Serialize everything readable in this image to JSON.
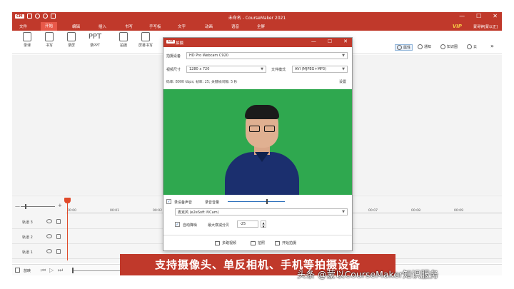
{
  "window": {
    "logo": "CM",
    "title": "未命名 - CourseMaker 2021",
    "min": "—",
    "max": "☐",
    "close": "✕"
  },
  "menu": {
    "items": [
      "文件",
      "开始",
      "编辑",
      "插入",
      "书写",
      "手写板",
      "文字",
      "动画",
      "语音",
      "全屏"
    ],
    "vip": "VIP",
    "user": "蒙哥钟[蒙以正]"
  },
  "ribbon": {
    "tools": [
      "录课",
      "书写",
      "录屏",
      "录PPT",
      "拍摄",
      "屏幕书写"
    ],
    "ppt_glyph": "PPT",
    "right_tools": [
      "属性",
      "通知",
      "知识圈",
      "云"
    ],
    "more": "»"
  },
  "timeline": {
    "ticks": [
      "00:00",
      "00:01",
      "00:02",
      "00:07",
      "00:08",
      "00:09"
    ],
    "tracks": [
      "轨道 3",
      "轨道 2",
      "轨道 1"
    ],
    "zoom_minus": "—",
    "zoom_plus": "+"
  },
  "bottombar": {
    "label": "放映"
  },
  "dialog": {
    "logo": "CM",
    "title": "拍摄",
    "device_label": "拍摄设备",
    "device_value": "HD Pro Webcam C920",
    "size_label": "视频尺寸",
    "size_value": "1280 x 720",
    "format_label": "文件模式",
    "format_value": "AVI (MJPEG+MP3)",
    "info": "码率: 8000 kbps; 帧率: 25; 关键帧间隔: 5 秒",
    "settings": "设置",
    "record_sound_label": "录设备声音",
    "volume_label": "录音音量",
    "volume_level": 0.68,
    "mic_value": "麦克风 (e2eSoft iVCam)",
    "noise_label": "自动降噪",
    "noise_max_label": "最大衰减分贝",
    "noise_value": "-25",
    "btn_multi": "多路视频",
    "btn_photo": "拍照",
    "btn_start": "开始拍摄"
  },
  "caption": {
    "banner": "支持摄像头、单反相机、手机等拍摄设备",
    "watermark": "头条 @蒙以CourseMaker知识服务"
  }
}
